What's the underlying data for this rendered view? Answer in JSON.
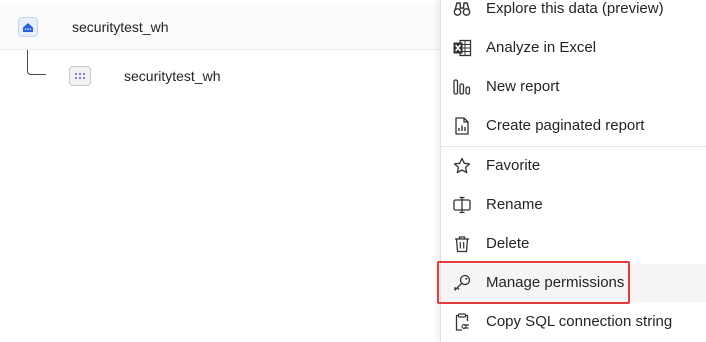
{
  "tree": {
    "parent": {
      "label": "securitytest_wh",
      "icon": "warehouse-icon"
    },
    "child": {
      "label": "securitytest_wh",
      "icon": "semantic-model-icon"
    }
  },
  "menu": {
    "items": [
      {
        "label": "Explore this data (preview)",
        "icon": "binoculars-icon"
      },
      {
        "label": "Analyze in Excel",
        "icon": "excel-icon"
      },
      {
        "label": "New report",
        "icon": "bar-chart-icon"
      },
      {
        "label": "Create paginated report",
        "icon": "paginated-report-icon"
      },
      {
        "label": "Favorite",
        "icon": "star-icon"
      },
      {
        "label": "Rename",
        "icon": "rename-icon"
      },
      {
        "label": "Delete",
        "icon": "trash-icon"
      },
      {
        "label": "Manage permissions",
        "icon": "key-icon"
      },
      {
        "label": "Copy SQL connection string",
        "icon": "clipboard-link-icon"
      }
    ]
  },
  "colors": {
    "highlight": "#e23b3b",
    "warehouse_icon": "#2b5fd9",
    "semantic_icon_dots": "#5b5fc7"
  }
}
